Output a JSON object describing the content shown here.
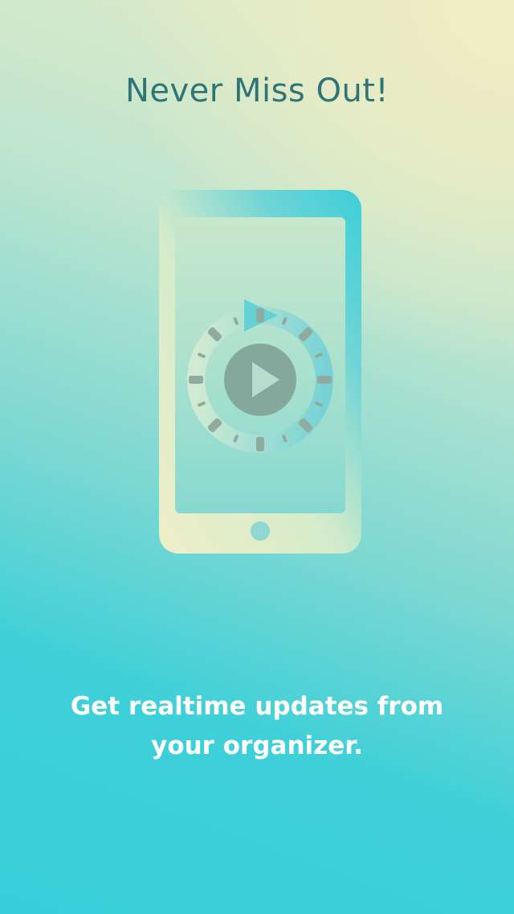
{
  "screen": {
    "title": "Never Miss Out!",
    "subtitle": "Get realtime updates from your organizer.",
    "illustration": {
      "device_icon": "smartphone-icon",
      "center_icon": "play-icon",
      "ring_icon": "refresh-cycle-icon"
    }
  },
  "colors": {
    "title_text": "#2f7576",
    "subtitle_text": "#ffffff",
    "gradient_light": "#eaecc4",
    "gradient_teal": "#36cfd9"
  }
}
